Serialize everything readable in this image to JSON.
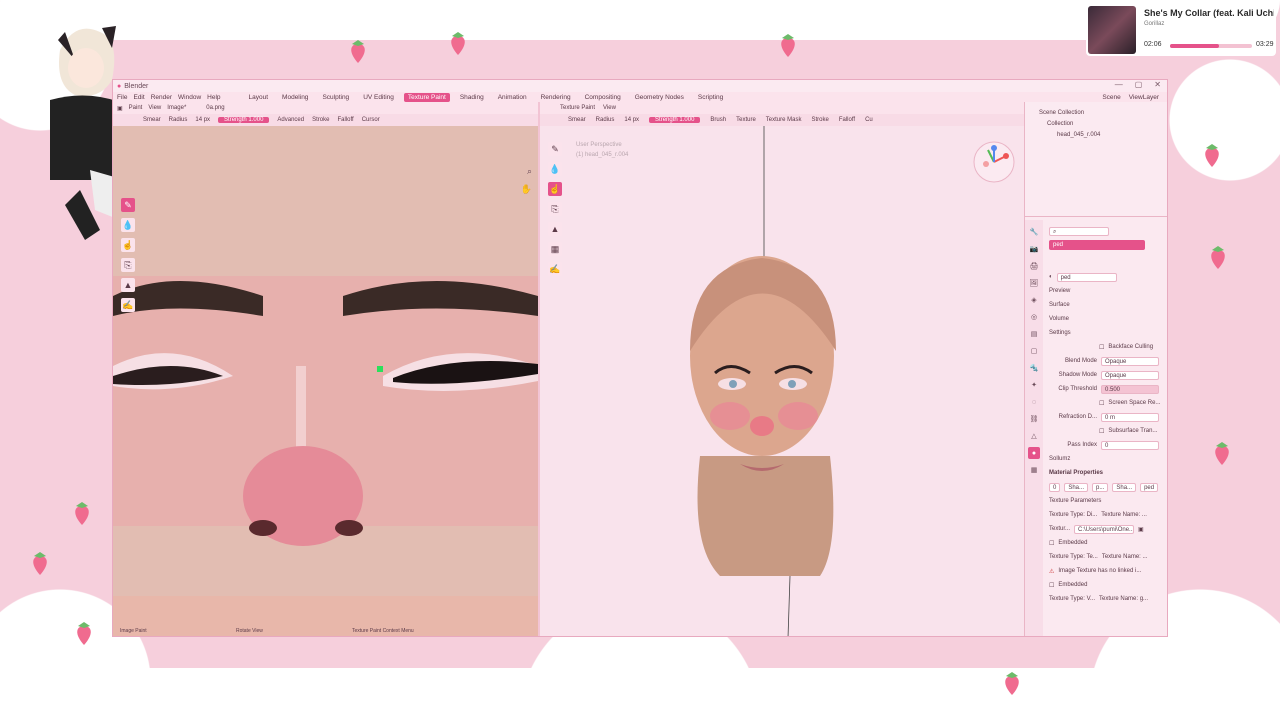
{
  "music": {
    "title": "She's My Collar (feat. Kali Uchis)",
    "artist": "Gorillaz",
    "elapsed": "02:06",
    "duration": "03:29",
    "progress": 0.6
  },
  "blender": {
    "title": "Blender",
    "menu": [
      "File",
      "Edit",
      "Render",
      "Window",
      "Help"
    ],
    "workspaces": [
      "Layout",
      "Modeling",
      "Sculpting",
      "UV Editing",
      "Texture Paint",
      "Shading",
      "Animation",
      "Rendering",
      "Compositing",
      "Geometry Nodes",
      "Scripting"
    ],
    "active_workspace": "Texture Paint",
    "scene": "Scene",
    "view_layer": "ViewLayer",
    "image_editor": {
      "mode": "Paint",
      "menus": [
        "View",
        "Image*"
      ],
      "image_name": "0a.png",
      "brush": "Smear",
      "radius_label": "Radius",
      "radius_value": "14 px",
      "strength_label": "Strength",
      "strength_value": "1.000",
      "extra": [
        "Advanced",
        "Stroke",
        "Falloff",
        "Cursor"
      ]
    },
    "viewport": {
      "mode": "Texture Paint",
      "menu": "View",
      "brush": "Smear",
      "radius_label": "Radius",
      "radius_value": "14 px",
      "strength_label": "Strength",
      "strength_value": "1.000",
      "extra": [
        "Brush",
        "Texture",
        "Texture Mask",
        "Stroke",
        "Falloff",
        "Cu"
      ],
      "overlay_text1": "User Perspective",
      "overlay_text2": "(1) head_045_r.004"
    },
    "outliner": {
      "root": "Scene Collection",
      "collection": "Collection",
      "object": "head_045_r.004"
    },
    "properties": {
      "material_slot": "ped",
      "material_name": "ped",
      "sections": [
        "Preview",
        "Surface",
        "Volume",
        "Settings"
      ],
      "backface_culling": "Backface Culling",
      "blend_mode_label": "Blend Mode",
      "blend_mode": "Opaque",
      "shadow_mode_label": "Shadow Mode",
      "shadow_mode": "Opaque",
      "clip_threshold_label": "Clip Threshold",
      "clip_threshold": "0.500",
      "screen_space": "Screen Space Re...",
      "refraction_label": "Refraction D...",
      "refraction_value": "0 m",
      "subsurface": "Subsurface Tran...",
      "pass_index_label": "Pass Index",
      "pass_index": "0",
      "addon": "Sollumz",
      "material_properties": "Material Properties",
      "mat_fields": [
        "0",
        "Sha...",
        "p...",
        "Sha...",
        "ped"
      ],
      "texture_params": "Texture Parameters",
      "tex1_type": "Texture Type: Di...",
      "tex1_name": "Texture Name: ...",
      "tex1_path_label": "Textur...",
      "tex1_path": "C:\\Users\\pumi\\One...",
      "embedded": "Embedded",
      "tex2_type": "Texture Type: Te...",
      "tex2_name": "Texture Name: ...",
      "tex2_warning": "Image Texture has no linked i...",
      "tex3_type": "Texture Type: V...",
      "tex3_name": "Texture Name: g..."
    },
    "status": [
      "Image Paint",
      "Rotate View",
      "Texture Paint Context Menu"
    ]
  }
}
